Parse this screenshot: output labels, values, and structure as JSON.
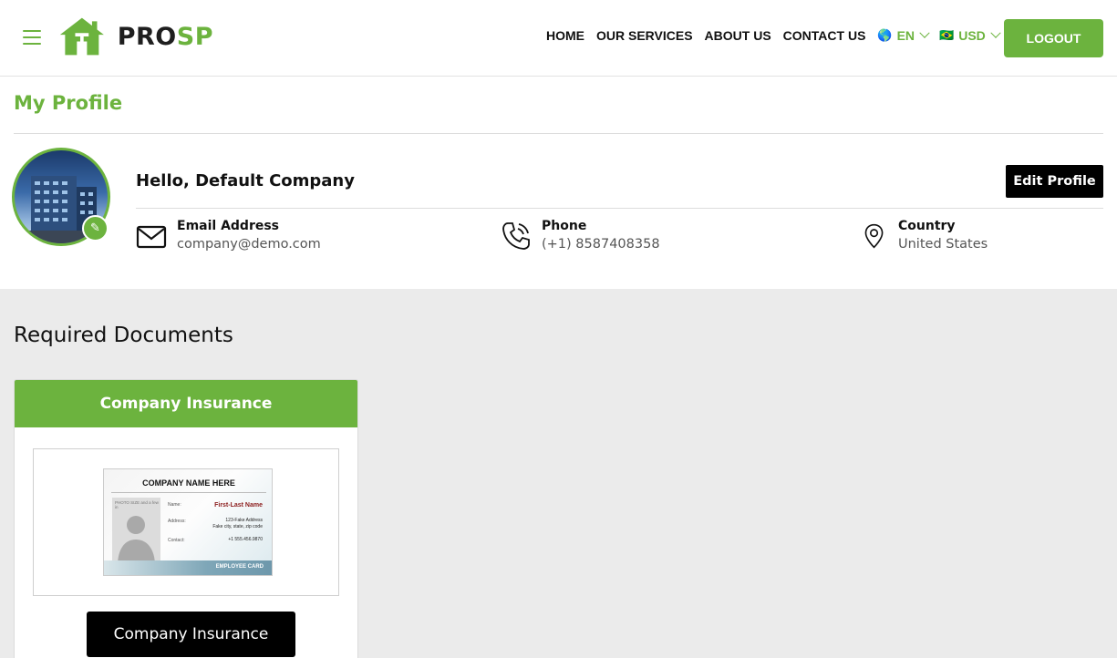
{
  "header": {
    "logo_text_a": "PRO",
    "logo_text_b": "SP",
    "nav": [
      "HOME",
      "OUR SERVICES",
      "ABOUT US",
      "CONTACT US"
    ],
    "language": {
      "flag": "🌎",
      "value": "EN"
    },
    "currency": {
      "flag": "🇧🇷",
      "value": "USD"
    },
    "logout_label": "LOGOUT"
  },
  "profile": {
    "title": "My Profile",
    "greeting": "Hello, Default Company",
    "edit_label": "Edit Profile",
    "email": {
      "label": "Email Address",
      "value": "company@demo.com"
    },
    "phone": {
      "label": "Phone",
      "value": "(+1) 8587408358"
    },
    "country": {
      "label": "Country",
      "value": "United States"
    }
  },
  "documents": {
    "title": "Required Documents",
    "cards": [
      {
        "header": "Company Insurance",
        "button": "Company Insurance",
        "id_card": {
          "title": "COMPANY NAME HERE",
          "photo_text": "PHOTO SIZE and a few in",
          "name_label": "Name:",
          "name_value": "First-Last Name",
          "address_label": "Address:",
          "address_line1": "123-Fake Address",
          "address_line2": "Fake city, state, zip code",
          "contact_label": "Contact:",
          "contact_value": "+1 555.456.9870",
          "footer": "EMPLOYEE CARD"
        }
      }
    ]
  },
  "colors": {
    "accent": "#6cb33e",
    "dark": "#000000",
    "background": "#ebebeb"
  }
}
